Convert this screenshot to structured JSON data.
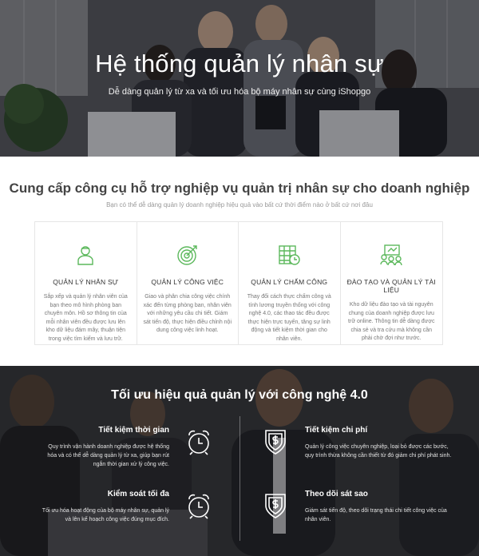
{
  "hero": {
    "title": "Hệ thống quản lý nhân sự",
    "subtitle": "Dễ dàng quản lý từ xa và tối ưu hóa bộ máy nhân sự cùng iShopgo"
  },
  "services": {
    "title": "Cung cấp công cụ hỗ trợ nghiệp vụ quản trị nhân sự cho doanh nghiệp",
    "subtitle": "Bạn có thể dễ dàng quản lý doanh nghiệp hiệu quả vào bất cứ thời điểm nào ở bất cứ nơi đâu",
    "accent": "#5cb85c",
    "cards": [
      {
        "icon": "person-icon",
        "title": "QUẢN LÝ NHÂN SỰ",
        "desc": "Sắp xếp và quản lý nhân viên của bạn theo mô hình phòng ban chuyên môn. Hồ sơ thông tin của mỗi nhân viên đều được lưu lên kho dữ liệu đám mây, thuận tiện trong việc tìm kiếm và lưu trữ."
      },
      {
        "icon": "target-icon",
        "title": "QUẢN LÝ CÔNG VIỆC",
        "desc": "Giao và phân chia công việc chính xác đến từng phòng ban, nhân viên với những yêu cầu chi tiết. Giám sát tiến độ, thực hiện điều chỉnh nội dung công việc linh hoạt."
      },
      {
        "icon": "timesheet-icon",
        "title": "QUẢN LÝ CHẤM CÔNG",
        "desc": "Thay đổi cách thực chấm công và tính lương truyền thống với công nghệ 4.0, các thao tác đều được thực hiện trực tuyến, tăng sự linh động và tiết kiệm thời gian cho nhân viên."
      },
      {
        "icon": "training-icon",
        "title": "ĐÀO TẠO VÀ QUẢN LÝ TÀI LIỆU",
        "desc": "Kho dữ liệu đào tạo và tài nguyên chung của doanh nghiệp được lưu trữ online. Thông tin dễ dàng được chia sẻ và tra cứu mà không cần phải chờ đợi như trước."
      }
    ]
  },
  "optimize": {
    "title": "Tối ưu hiệu quả quản lý với công nghệ 4.0",
    "features": [
      {
        "icon": "alarm-clock-icon",
        "title": "Tiết kiệm thời gian",
        "desc": "Quy trình vận hành doanh nghiệp được hệ thống hóa và có thể dễ dàng quản lý từ xa, giúp bạn rút ngắn thời gian xử lý công việc."
      },
      {
        "icon": "dollar-shield-icon",
        "title": "Tiết kiệm chi phí",
        "desc": "Quản lý công việc chuyên nghiệp, loại bỏ được các bước, quy trình thừa không cần thiết từ đó giảm chi phí phát sinh."
      },
      {
        "icon": "alarm-clock-icon",
        "title": "Kiểm soát tối đa",
        "desc": "Tối ưu hóa hoạt động của bộ máy nhân sự, quản lý và lên kế hoạch công việc đúng mục đích."
      },
      {
        "icon": "dollar-shield-icon",
        "title": "Theo dõi sát sao",
        "desc": "Giám sát tiến độ, theo dõi trạng thái chi tiết công việc của nhân viên."
      }
    ]
  }
}
